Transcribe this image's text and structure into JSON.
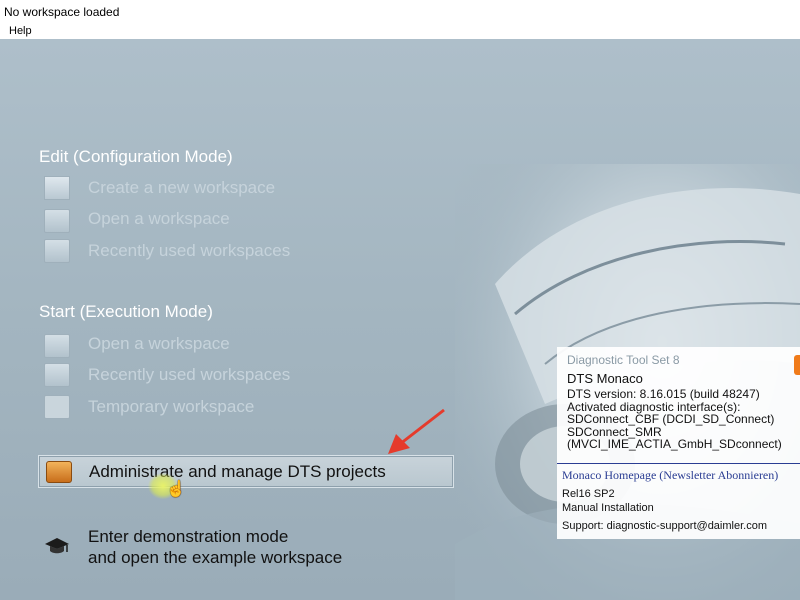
{
  "window": {
    "title": "No workspace loaded"
  },
  "menubar": {
    "items": [
      "Help"
    ]
  },
  "edit_section": {
    "heading": "Edit (Configuration Mode)",
    "items": [
      {
        "label": "Create a new workspace",
        "icon": "new-workspace-icon"
      },
      {
        "label": "Open a workspace",
        "icon": "open-folder-icon"
      },
      {
        "label": "Recently used workspaces",
        "icon": "recent-workspaces-icon"
      }
    ]
  },
  "start_section": {
    "heading": "Start (Execution Mode)",
    "items": [
      {
        "label": "Open a workspace",
        "icon": "open-folder-icon"
      },
      {
        "label": "Recently used workspaces",
        "icon": "recent-workspaces-icon"
      },
      {
        "label": "Temporary workspace",
        "icon": "temporary-workspace-icon"
      }
    ]
  },
  "admin_button": {
    "label": "Administrate and manage DTS projects",
    "icon": "briefcase-icon"
  },
  "demo": {
    "line1": "Enter demonstration mode",
    "line2": "and open the example workspace",
    "icon": "graduation-cap-icon"
  },
  "about": {
    "product": "Diagnostic Tool Set 8",
    "name": "DTS Monaco",
    "version": "DTS version: 8.16.015 (build 48247)",
    "interfaces_label": "Activated diagnostic interface(s):",
    "interfaces": [
      "SDConnect_CBF (DCDI_SD_Connect)",
      "SDConnect_SMR",
      "(MVCI_IME_ACTIA_GmbH_SDconnect)"
    ],
    "link": "Monaco Homepage (Newsletter Abonnieren)",
    "release": "Rel16 SP2",
    "installation": "Manual Installation",
    "support": "Support: diagnostic-support@daimler.com"
  },
  "colors": {
    "background": "#a4b6c1",
    "link": "#2a3d93",
    "annotation_arrow": "#e53b2c",
    "cursor_highlight": "#e8f26a"
  }
}
